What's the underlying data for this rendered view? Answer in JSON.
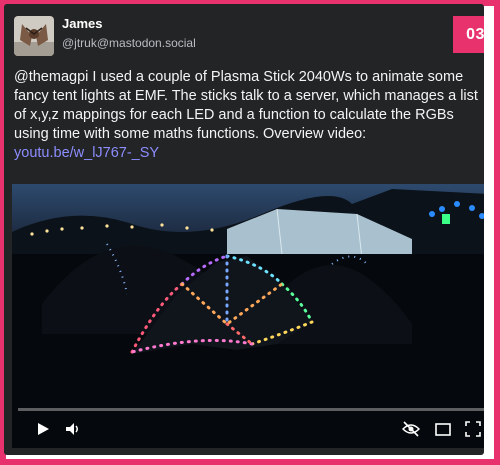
{
  "badge": "03",
  "author": {
    "name": "James",
    "handle": "@jtruk@mastodon.social"
  },
  "post": {
    "text": "@themagpi I used a couple of Plasma Stick 2040Ws to animate some fancy tent lights at EMF. The sticks talk to a server, which manages a list of x,y,z mappings for each LED and a function to calculate the RGBs using time with some maths functions. Overview video: ",
    "link": "youtu.be/w_lJ767-_SY"
  },
  "video": {
    "progress_percent": 0
  },
  "colors": {
    "accent": "#e8326d",
    "card": "#232425",
    "link": "#8c8dff"
  },
  "icons": [
    "play-icon",
    "volume-icon",
    "captions-off-icon",
    "miniplayer-icon",
    "fullscreen-icon"
  ]
}
